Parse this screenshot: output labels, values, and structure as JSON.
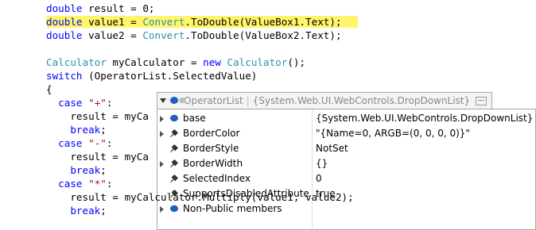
{
  "code": [
    {
      "t": 2,
      "segs": [
        {
          "c": "kw",
          "s": "double"
        },
        {
          "c": "",
          "s": " result = 0;"
        }
      ]
    },
    {
      "t": 19,
      "hl": true,
      "segs": [
        {
          "c": "kw",
          "s": "double"
        },
        {
          "c": "",
          "s": " value1 = "
        },
        {
          "c": "ty",
          "s": "Convert"
        },
        {
          "c": "",
          "s": ".ToDouble(ValueBox1.Text);"
        }
      ]
    },
    {
      "t": 36,
      "segs": [
        {
          "c": "kw",
          "s": "double"
        },
        {
          "c": "",
          "s": " value2 = "
        },
        {
          "c": "ty",
          "s": "Convert"
        },
        {
          "c": "",
          "s": ".ToDouble(ValueBox2.Text);"
        }
      ]
    },
    {
      "t": 70,
      "segs": [
        {
          "c": "ty",
          "s": "Calculator"
        },
        {
          "c": "",
          "s": " myCalculator = "
        },
        {
          "c": "kw",
          "s": "new"
        },
        {
          "c": "",
          "s": " "
        },
        {
          "c": "ty",
          "s": "Calculator"
        },
        {
          "c": "",
          "s": "();"
        }
      ]
    },
    {
      "t": 87,
      "segs": [
        {
          "c": "kw",
          "s": "switch"
        },
        {
          "c": "",
          "s": " (OperatorList.SelectedValue)"
        }
      ]
    },
    {
      "t": 104,
      "segs": [
        {
          "c": "",
          "s": "{"
        }
      ]
    },
    {
      "t": 121,
      "segs": [
        {
          "c": "",
          "s": "  "
        },
        {
          "c": "kw",
          "s": "case"
        },
        {
          "c": "",
          "s": " "
        },
        {
          "c": "str",
          "s": "\"+\""
        },
        {
          "c": "",
          "s": ":"
        }
      ]
    },
    {
      "t": 138,
      "segs": [
        {
          "c": "",
          "s": "    result = myCa"
        }
      ]
    },
    {
      "t": 155,
      "segs": [
        {
          "c": "",
          "s": "    "
        },
        {
          "c": "kw",
          "s": "break"
        },
        {
          "c": "",
          "s": ";"
        }
      ]
    },
    {
      "t": 172,
      "segs": [
        {
          "c": "",
          "s": "  "
        },
        {
          "c": "kw",
          "s": "case"
        },
        {
          "c": "",
          "s": " "
        },
        {
          "c": "str",
          "s": "\"-\""
        },
        {
          "c": "",
          "s": ":"
        }
      ]
    },
    {
      "t": 189,
      "segs": [
        {
          "c": "",
          "s": "    result = myCa"
        }
      ]
    },
    {
      "t": 206,
      "segs": [
        {
          "c": "",
          "s": "    "
        },
        {
          "c": "kw",
          "s": "break"
        },
        {
          "c": "",
          "s": ";"
        }
      ]
    },
    {
      "t": 223,
      "segs": [
        {
          "c": "",
          "s": "  "
        },
        {
          "c": "kw",
          "s": "case"
        },
        {
          "c": "",
          "s": " "
        },
        {
          "c": "str",
          "s": "\"*\""
        },
        {
          "c": "",
          "s": ":"
        }
      ]
    },
    {
      "t": 240,
      "segs": [
        {
          "c": "",
          "s": "    result = myCalculator.Multiply(value1, value2);"
        }
      ]
    },
    {
      "t": 257,
      "segs": [
        {
          "c": "",
          "s": "    "
        },
        {
          "c": "kw",
          "s": "break"
        },
        {
          "c": "",
          "s": ";"
        }
      ]
    }
  ],
  "datatip": {
    "object_name": "OperatorList",
    "object_value": "{System.Web.UI.WebControls.DropDownList}",
    "rows": [
      {
        "name": "base",
        "value": "{System.Web.UI.WebControls.DropDownList}",
        "icon": "object-icon",
        "expandable": true
      },
      {
        "name": "BorderColor",
        "value": "\"{Name=0, ARGB=(0, 0, 0, 0)}\"",
        "icon": "property-icon",
        "expandable": true
      },
      {
        "name": "BorderStyle",
        "value": "NotSet",
        "icon": "property-icon",
        "expandable": false
      },
      {
        "name": "BorderWidth",
        "value": "{}",
        "icon": "property-icon",
        "expandable": true
      },
      {
        "name": "SelectedIndex",
        "value": "0",
        "icon": "property-icon",
        "expandable": false
      },
      {
        "name": "SupportsDisabledAttribute",
        "value": "true",
        "icon": "property-icon",
        "expandable": false
      },
      {
        "name": "Non-Public members",
        "value": "",
        "icon": "object-icon",
        "expandable": true
      }
    ]
  },
  "colors": {
    "keyword": "#0000ff",
    "type": "#2b91af",
    "string": "#a31515",
    "highlight": "#fff56b"
  }
}
